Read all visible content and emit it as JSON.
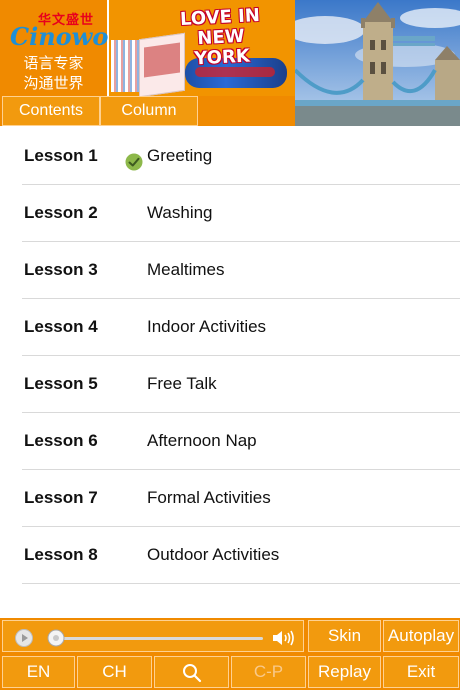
{
  "header": {
    "brand_cn_top": "华文盛世",
    "brand_logo": "Cinowo",
    "brand_tagline_1": "语言专家",
    "brand_tagline_2": "沟通世界",
    "banner_title": "LOVE IN NEW YORK",
    "tabs": [
      {
        "label": "Contents"
      },
      {
        "label": "Column"
      }
    ]
  },
  "lessons": [
    {
      "number": "Lesson 1",
      "title": "Greeting",
      "completed": true
    },
    {
      "number": "Lesson 2",
      "title": "Washing",
      "completed": false
    },
    {
      "number": "Lesson 3",
      "title": "Mealtimes",
      "completed": false
    },
    {
      "number": "Lesson 4",
      "title": "Indoor Activities",
      "completed": false
    },
    {
      "number": "Lesson 5",
      "title": "Free Talk",
      "completed": false
    },
    {
      "number": "Lesson 6",
      "title": "Afternoon Nap",
      "completed": false
    },
    {
      "number": "Lesson 7",
      "title": "Formal Activities",
      "completed": false
    },
    {
      "number": "Lesson 8",
      "title": "Outdoor Activities",
      "completed": false
    }
  ],
  "player": {
    "progress": 0,
    "icons": {
      "play": "play-icon",
      "volume": "volume-icon"
    }
  },
  "controls": {
    "skin": "Skin",
    "autoplay": "Autoplay",
    "en": "EN",
    "ch": "CH",
    "search_icon": "search-icon",
    "cp": "C-P",
    "replay": "Replay",
    "exit": "Exit"
  },
  "colors": {
    "accent": "#f08a00",
    "button": "#f29a0e",
    "button_border": "#ffd190",
    "check": "#8db84a",
    "divider": "#d9d9d9"
  }
}
